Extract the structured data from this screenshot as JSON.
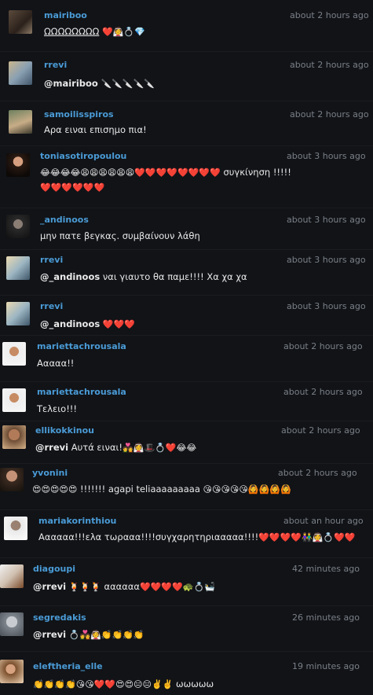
{
  "comments": [
    {
      "user": "mairiboo",
      "time": "about 2 hours ago",
      "text": "ΩΩΩΩΩΩΩΩ",
      "emoji": "❤️👰💍💎"
    },
    {
      "user": "rrevi",
      "time": "about 2 hours ago",
      "mention": "@mairiboo",
      "text": "",
      "emoji": "🔪🔪🔪🔪🔪"
    },
    {
      "user": "samoilisspiros",
      "time": "about 2 hours ago",
      "text": "Αρα ειναι επισημο πια!",
      "emoji": ""
    },
    {
      "user": "toniasotiropoulou",
      "time": "about 3 hours ago",
      "text": "συγκίνηση !!!!!",
      "emoji": "😂😂😂😂😩😩😩😩😩😩❤️❤️❤️❤️❤️❤️❤️❤️",
      "emoji2": "❤️❤️❤️❤️❤️❤️"
    },
    {
      "user": "_andinoos",
      "time": "about 3 hours ago",
      "text": "μην πατε βεγκας. συμβαίνουν λάθη",
      "emoji": ""
    },
    {
      "user": "rrevi",
      "time": "about 3 hours ago",
      "mention": "@_andinoos",
      "text": "ναι γιαυτο θα παμε!!!! Χα χα χα",
      "emoji": ""
    },
    {
      "user": "rrevi",
      "time": "about 3 hours ago",
      "mention": "@_andinoos",
      "text": "",
      "emoji": "❤️❤️❤️"
    },
    {
      "user": "mariettachrousala",
      "time": "about 2 hours ago",
      "text": "Ααααα!!",
      "emoji": ""
    },
    {
      "user": "mariettachrousala",
      "time": "about 2 hours ago",
      "text": "Τελειο!!!",
      "emoji": ""
    },
    {
      "user": "ellikokkinou",
      "time": "about 2 hours ago",
      "mention": "@rrevi",
      "text": "Αυτά ειναι!",
      "emoji": "💑👰🎩💍❤️😂😂"
    },
    {
      "user": "yvonini",
      "time": "about 2 hours ago",
      "text": "!!!!!!! agapi teliaaaaaaaaa",
      "emoji": "😍😍😍😍😍",
      "emoji_after": "😘😘😘😘😘🙆🙆🙆🙆"
    },
    {
      "user": "mariakorinthiou",
      "time": "about an hour ago",
      "text": "Αααααα!!!ελα τωρααα!!!!συγχαρητηριααααα!!!!",
      "emoji": "❤️❤️❤️❤️👫👰💍❤️❤️"
    },
    {
      "user": "diagoupi",
      "time": "42 minutes ago",
      "mention": "@rrevi",
      "text": "αααααα",
      "emoji": "🍹🍹🍹",
      "emoji_after": "❤️❤️❤️❤️🐢💍🛀"
    },
    {
      "user": "segredakis",
      "time": "26 minutes ago",
      "mention": "@rrevi",
      "text": "",
      "emoji": "💍💑👰👏👏👏👏"
    },
    {
      "user": "eleftheria_elle",
      "time": "19 minutes ago",
      "text": "ωωωωω",
      "emoji": "👏👏👏👏😘😘❤️❤️😍😍😑😑✌️✌️"
    }
  ]
}
